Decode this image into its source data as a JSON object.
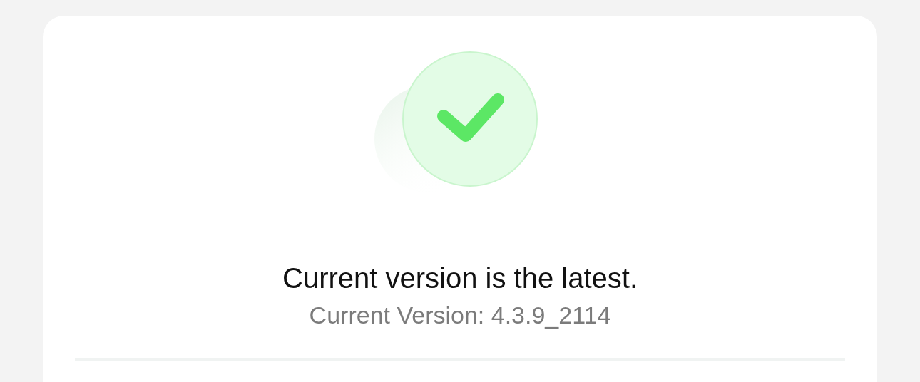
{
  "status": {
    "kind": "success",
    "title": "Current version is the latest.",
    "version": "Current Version: 4.3.9_2114"
  }
}
